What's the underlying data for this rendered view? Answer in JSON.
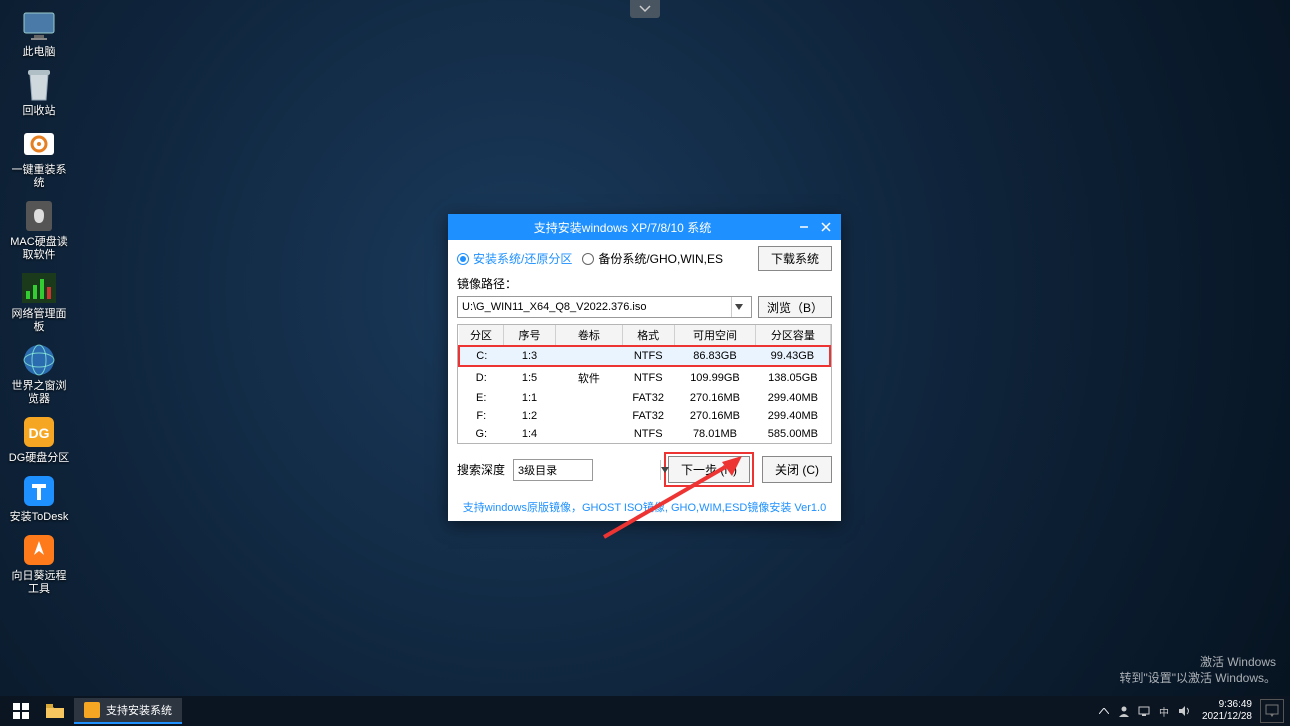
{
  "top_tab": {
    "icon": "chevron-down"
  },
  "desktop_icons": [
    {
      "name": "computer-icon",
      "label": "此电脑",
      "svg": "pc"
    },
    {
      "name": "recycle-icon",
      "label": "回收站",
      "svg": "bin"
    },
    {
      "name": "reinstall-icon",
      "label": "一键重装系统",
      "svg": "gear"
    },
    {
      "name": "mac-read-icon",
      "label": "MAC硬盘读取软件",
      "svg": "apple"
    },
    {
      "name": "netpanel-icon",
      "label": "网络管理面板",
      "svg": "chart"
    },
    {
      "name": "world-browser-icon",
      "label": "世界之窗浏览器",
      "svg": "globe"
    },
    {
      "name": "dg-partition-icon",
      "label": "DG硬盘分区",
      "svg": "dg"
    },
    {
      "name": "todesk-icon",
      "label": "安装ToDesk",
      "svg": "todesk"
    },
    {
      "name": "sunflower-icon",
      "label": "向日葵远程工具",
      "svg": "sun"
    }
  ],
  "dialog": {
    "title": "支持安装windows XP/7/8/10 系统",
    "opt_install": "安装系统/还原分区",
    "opt_backup": "备份系统/GHO,WIN,ES",
    "download_btn": "下载系统",
    "path_label": "镜像路径：",
    "path_value": "U:\\G_WIN11_X64_Q8_V2022.376.iso",
    "browse_btn": "浏览（B）",
    "columns": [
      "分区",
      "序号",
      "卷标",
      "格式",
      "可用空间",
      "分区容量"
    ],
    "rows": [
      {
        "p": "C:",
        "n": "1:3",
        "v": "",
        "f": "NTFS",
        "free": "86.83GB",
        "cap": "99.43GB",
        "sel": true
      },
      {
        "p": "D:",
        "n": "1:5",
        "v": "软件",
        "f": "NTFS",
        "free": "109.99GB",
        "cap": "138.05GB",
        "sel": false
      },
      {
        "p": "E:",
        "n": "1:1",
        "v": "",
        "f": "FAT32",
        "free": "270.16MB",
        "cap": "299.40MB",
        "sel": false
      },
      {
        "p": "F:",
        "n": "1:2",
        "v": "",
        "f": "FAT32",
        "free": "270.16MB",
        "cap": "299.40MB",
        "sel": false
      },
      {
        "p": "G:",
        "n": "1:4",
        "v": "",
        "f": "NTFS",
        "free": "78.01MB",
        "cap": "585.00MB",
        "sel": false
      }
    ],
    "depth_label": "搜索深度",
    "depth_value": "3级目录",
    "next_btn": "下一步 (N)",
    "close_btn": "关闭 (C)",
    "footer": "支持windows原版镜像，GHOST ISO镜像, GHO,WIM,ESD镜像安装 Ver1.0"
  },
  "taskbar": {
    "task_label": "支持安装系统",
    "clock_time": "9:36:49",
    "clock_date": "2021/12/28"
  },
  "watermark": {
    "line1": "激活 Windows",
    "line2": "转到\"设置\"以激活 Windows。"
  }
}
